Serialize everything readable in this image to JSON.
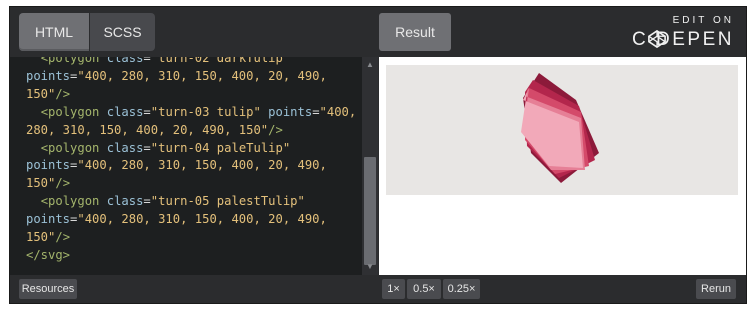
{
  "tabs": {
    "html": "HTML",
    "scss": "SCSS",
    "result": "Result"
  },
  "brand": {
    "edit_on": "EDIT ON",
    "codepen": "C DEPEN"
  },
  "code_lines": [
    [
      "  <polygon ",
      "class",
      "=",
      "\"turn-02 darkTulip\"",
      "",
      "",
      ""
    ],
    [
      "points",
      "=",
      "\"400, 280, 310, 150, 400, 20, 490,",
      "",
      "",
      "",
      ""
    ]
  ],
  "code": {
    "l1": {
      "indent": "  ",
      "tag": "<polygon",
      "attr": "class",
      "val": "\"turn-02 darkTulip\""
    },
    "l2": {
      "attr": "points",
      "val": "\"400, 280, 310, 150, 400, 20, 490,"
    },
    "l3": {
      "val": "150\"",
      "tag": "/>"
    },
    "l4": {
      "indent": "  ",
      "tag": "<polygon",
      "attr1": "class",
      "val1": "\"turn-03 tulip\"",
      "attr2": "points",
      "val2": "\"400,"
    },
    "l5": {
      "val": "280, 310, 150, 400, 20, 490, 150\"",
      "tag": "/>"
    },
    "l6": {
      "indent": "  ",
      "tag": "<polygon",
      "attr": "class",
      "val": "\"turn-04 paleTulip\""
    },
    "l7": {
      "attr": "points",
      "val": "\"400, 280, 310, 150, 400, 20, 490,"
    },
    "l8": {
      "val": "150\"",
      "tag": "/>"
    },
    "l9": {
      "indent": "  ",
      "tag": "<polygon",
      "attr": "class",
      "val": "\"turn-05 palestTulip\""
    },
    "l10": {
      "attr": "points",
      "val": "\"400, 280, 310, 150, 400, 20, 490,"
    },
    "l11": {
      "val": "150\"",
      "tag": "/>"
    },
    "l12": {
      "tag": "</svg>"
    }
  },
  "footer": {
    "resources": "Resources",
    "zoom_1x": "1×",
    "zoom_05x": "0.5×",
    "zoom_025x": "0.25×",
    "rerun": "Rerun"
  },
  "colors": {
    "darkest": "#8c1a3a",
    "dark": "#b3264c",
    "mid": "#d44a6a",
    "light": "#e67f96",
    "pale": "#f2a9b9",
    "canvas": "#e8e6e4"
  }
}
